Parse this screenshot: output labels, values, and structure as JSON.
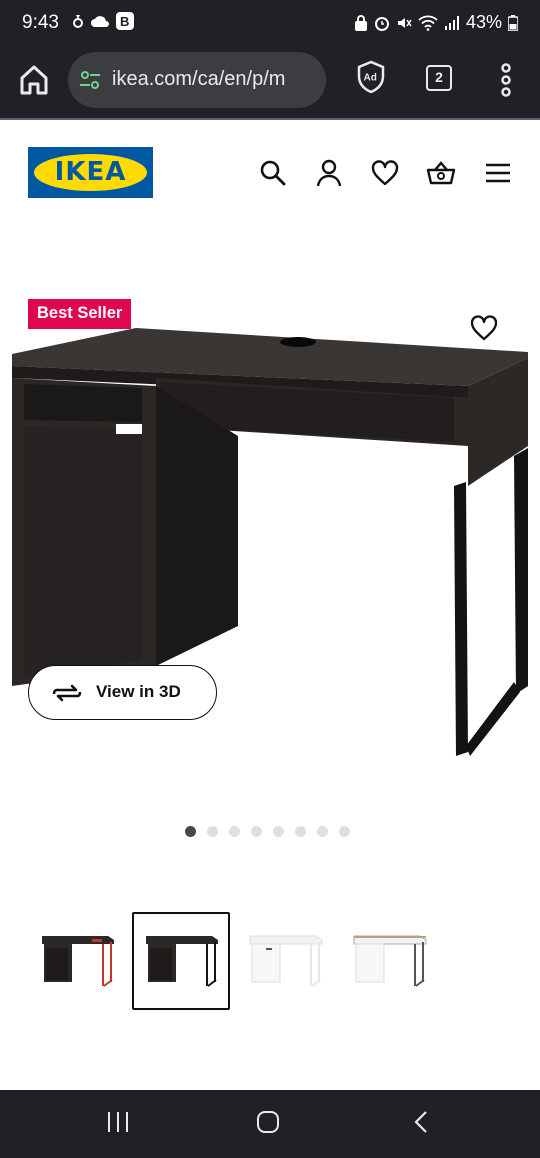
{
  "status_bar": {
    "time": "9:43",
    "battery": "43%"
  },
  "browser": {
    "url": "ikea.com/ca/en/p/m",
    "tab_count": "2",
    "adblock_label": "Ad"
  },
  "site": {
    "logo_text": "IKEA"
  },
  "product": {
    "badge": "Best Seller",
    "view_3d_label": "View in 3D",
    "image_count": 8,
    "active_image_index": 0,
    "thumbnails": [
      {
        "variant": "black-brown / red",
        "selected": false
      },
      {
        "variant": "black-brown",
        "selected": true
      },
      {
        "variant": "white",
        "selected": false
      },
      {
        "variant": "white / anthracite",
        "selected": false
      }
    ]
  },
  "colors": {
    "ikea_blue": "#0058a3",
    "ikea_yellow": "#ffdb00",
    "badge_red": "#e00751",
    "desk_dark": "#2b2826"
  }
}
